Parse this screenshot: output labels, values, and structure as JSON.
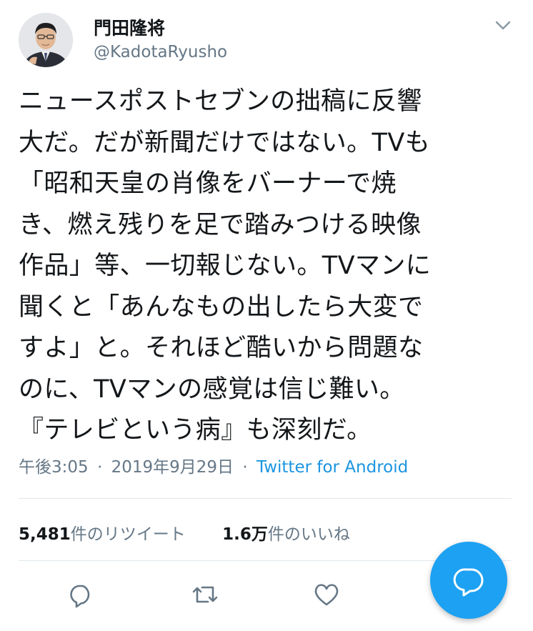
{
  "tweet": {
    "author": {
      "display_name": "門田隆将",
      "handle": "@KadotaRyusho",
      "avatar_icon": "user-avatar-photo"
    },
    "body_lines": [
      "ニュースポストセブンの拙稿に反響",
      "大だ。だが新聞だけではない。TVも",
      "「昭和天皇の肖像をバーナーで焼",
      "き、燃え残りを足で踏みつける映像",
      "作品」等、一切報じない。TVマンに",
      "聞くと「あんなもの出したら大変で",
      "すよ」と。それほど酷いから問題な",
      "のに、TVマンの感覚は信じ難い。",
      "『テレビという病』も深刻だ。"
    ],
    "time": "午後3:05",
    "date": "2019年9月29日",
    "separator": "·",
    "source": "Twitter for Android",
    "retweets": {
      "count": "5,481",
      "label": "件のリツイート"
    },
    "likes": {
      "count": "1.6万",
      "label": "件のいいね"
    }
  },
  "actions": {
    "reply_icon": "reply-icon",
    "retweet_icon": "retweet-icon",
    "like_icon": "heart-icon",
    "compose_icon": "compose-reply-icon"
  },
  "colors": {
    "text_primary": "#14171a",
    "text_secondary": "#657786",
    "link": "#1b95e0",
    "accent": "#1da1f2",
    "divider": "#e1e8ed"
  }
}
